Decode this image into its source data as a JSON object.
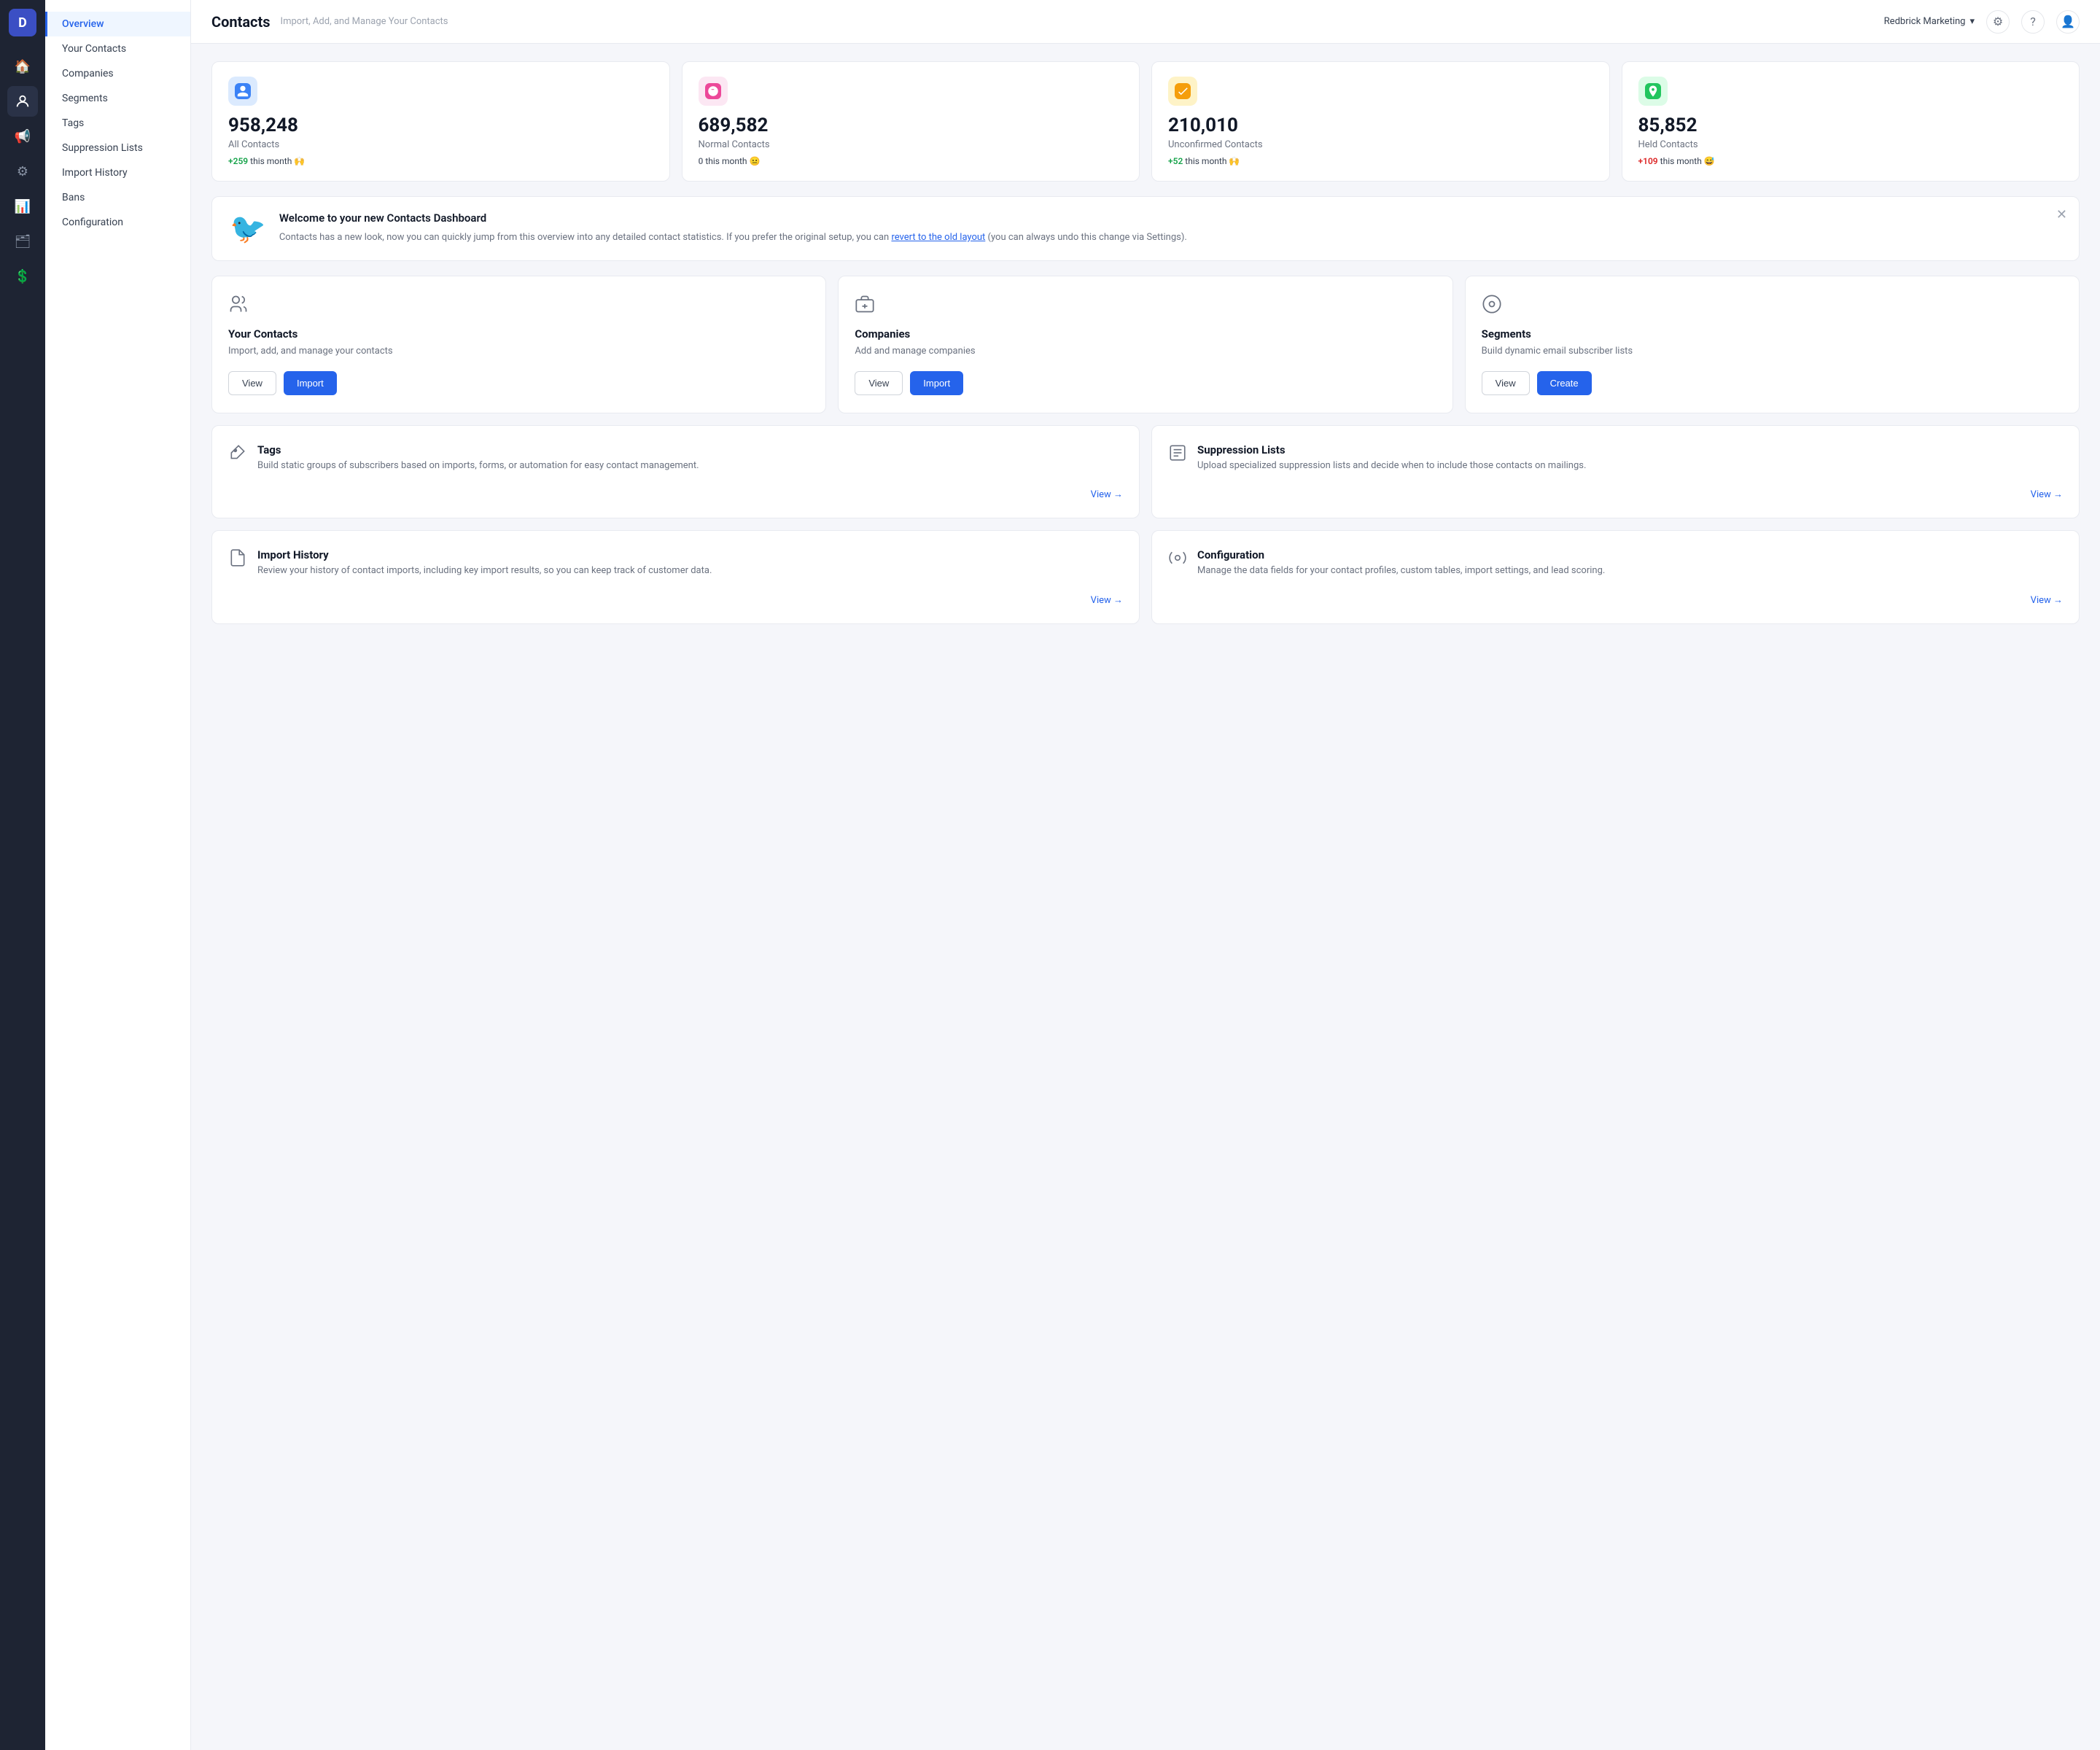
{
  "app": {
    "logo": "D",
    "title": "Contacts",
    "subtitle": "Import, Add, and Manage Your Contacts"
  },
  "topbar": {
    "org_name": "Redbrick Marketing",
    "chevron": "▾"
  },
  "sidebar": {
    "items": [
      {
        "id": "overview",
        "label": "Overview",
        "active": true
      },
      {
        "id": "your-contacts",
        "label": "Your Contacts"
      },
      {
        "id": "companies",
        "label": "Companies"
      },
      {
        "id": "segments",
        "label": "Segments"
      },
      {
        "id": "tags",
        "label": "Tags"
      },
      {
        "id": "suppression-lists",
        "label": "Suppression Lists"
      },
      {
        "id": "import-history",
        "label": "Import History"
      },
      {
        "id": "bans",
        "label": "Bans"
      },
      {
        "id": "configuration",
        "label": "Configuration"
      }
    ]
  },
  "stats": [
    {
      "icon": "👤",
      "icon_bg": "#3b82f6",
      "number": "958,248",
      "label": "All Contacts",
      "change": "+259",
      "change_type": "positive",
      "change_suffix": "this month 🙌"
    },
    {
      "icon": "😊",
      "icon_bg": "#ec4899",
      "number": "689,582",
      "label": "Normal Contacts",
      "change": "0",
      "change_type": "neutral",
      "change_suffix": "this month 😐"
    },
    {
      "icon": "✔",
      "icon_bg": "#f59e0b",
      "number": "210,010",
      "label": "Unconfirmed Contacts",
      "change": "+52",
      "change_type": "positive",
      "change_suffix": "this month 🙌"
    },
    {
      "icon": "🚫",
      "icon_bg": "#22c55e",
      "number": "85,852",
      "label": "Held Contacts",
      "change": "+109",
      "change_type": "negative",
      "change_suffix": "this month 😅"
    }
  ],
  "welcome_banner": {
    "title": "Welcome to your new Contacts Dashboard",
    "body_start": "Contacts has a new look, now you can quickly jump from this overview into any detailed contact statistics. If you prefer the original setup, you can ",
    "link_text": "revert to the old layout",
    "body_end": " (you can always undo this change via Settings)."
  },
  "feature_cards_3": [
    {
      "id": "your-contacts",
      "title": "Your Contacts",
      "description": "Import, add, and manage your contacts",
      "view_label": "View",
      "import_label": "Import"
    },
    {
      "id": "companies",
      "title": "Companies",
      "description": "Add and manage companies",
      "view_label": "View",
      "import_label": "Import"
    },
    {
      "id": "segments",
      "title": "Segments",
      "description": "Build dynamic email subscriber lists",
      "view_label": "View",
      "create_label": "Create"
    }
  ],
  "feature_cards_simple_row1": [
    {
      "id": "tags",
      "title": "Tags",
      "description": "Build static groups of subscribers based on imports, forms, or automation for easy contact management.",
      "view_label": "View →"
    },
    {
      "id": "suppression-lists",
      "title": "Suppression Lists",
      "description": "Upload specialized suppression lists and decide when to include those contacts on mailings.",
      "view_label": "View →"
    }
  ],
  "feature_cards_simple_row2": [
    {
      "id": "import-history",
      "title": "Import History",
      "description": "Review your history of contact imports, including key import results, so you can keep track of customer data.",
      "view_label": "View →"
    },
    {
      "id": "configuration",
      "title": "Configuration",
      "description": "Manage the data fields for your contact profiles, custom tables, import settings, and lead scoring.",
      "view_label": "View →"
    }
  ]
}
